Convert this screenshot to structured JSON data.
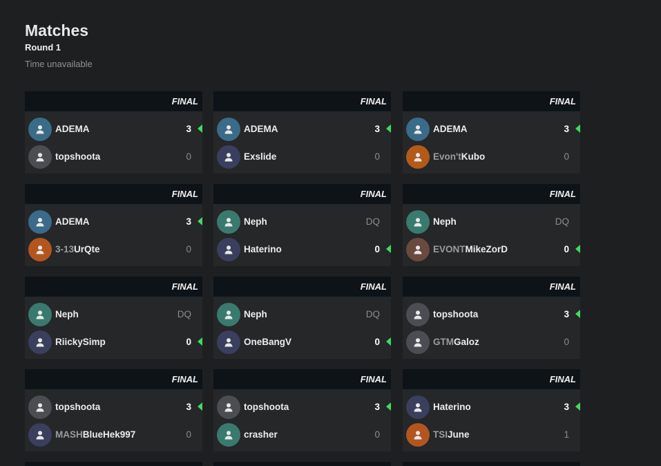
{
  "page": {
    "title": "Matches",
    "round": "Round 1",
    "time": "Time unavailable"
  },
  "colors": {
    "win_indicator": "#3ddc63"
  },
  "matches": [
    {
      "status": "FINAL",
      "players": [
        {
          "prefix": "",
          "name": "ADEMA",
          "score": "3",
          "winner": true,
          "avatar_color": "#3a6b88"
        },
        {
          "prefix": "",
          "name": "topshoota",
          "score": "0",
          "winner": false,
          "avatar_color": "#4a4e52"
        }
      ]
    },
    {
      "status": "FINAL",
      "players": [
        {
          "prefix": "",
          "name": "ADEMA",
          "score": "3",
          "winner": true,
          "avatar_color": "#3a6b88"
        },
        {
          "prefix": "",
          "name": "Exslide",
          "score": "0",
          "winner": false,
          "avatar_color": "#3a3f5e"
        }
      ]
    },
    {
      "status": "FINAL",
      "players": [
        {
          "prefix": "",
          "name": "ADEMA",
          "score": "3",
          "winner": true,
          "avatar_color": "#3a6b88"
        },
        {
          "prefix": "Evon't",
          "name": "Kubo",
          "score": "0",
          "winner": false,
          "avatar_color": "#b35a1a"
        }
      ]
    },
    {
      "status": "FINAL",
      "players": [
        {
          "prefix": "",
          "name": "ADEMA",
          "score": "3",
          "winner": true,
          "avatar_color": "#3a6b88"
        },
        {
          "prefix": "3-13",
          "name": "UrQte",
          "score": "0",
          "winner": false,
          "avatar_color": "#b3551f"
        }
      ]
    },
    {
      "status": "FINAL",
      "players": [
        {
          "prefix": "",
          "name": "Neph",
          "score": "DQ",
          "winner": false,
          "avatar_color": "#3a7a6e"
        },
        {
          "prefix": "",
          "name": "Haterino",
          "score": "0",
          "winner": true,
          "avatar_color": "#3a3f5e"
        }
      ]
    },
    {
      "status": "FINAL",
      "players": [
        {
          "prefix": "",
          "name": "Neph",
          "score": "DQ",
          "winner": false,
          "avatar_color": "#3a7a6e"
        },
        {
          "prefix": "EVONT",
          "name": "MikeZorD",
          "score": "0",
          "winner": true,
          "avatar_color": "#6a4a3e"
        }
      ]
    },
    {
      "status": "FINAL",
      "players": [
        {
          "prefix": "",
          "name": "Neph",
          "score": "DQ",
          "winner": false,
          "avatar_color": "#3a7a6e"
        },
        {
          "prefix": "",
          "name": "RiickySimp",
          "score": "0",
          "winner": true,
          "avatar_color": "#3a3f5e"
        }
      ]
    },
    {
      "status": "FINAL",
      "players": [
        {
          "prefix": "",
          "name": "Neph",
          "score": "DQ",
          "winner": false,
          "avatar_color": "#3a7a6e"
        },
        {
          "prefix": "",
          "name": "OneBangV",
          "score": "0",
          "winner": true,
          "avatar_color": "#3a3f5e"
        }
      ]
    },
    {
      "status": "FINAL",
      "players": [
        {
          "prefix": "",
          "name": "topshoota",
          "score": "3",
          "winner": true,
          "avatar_color": "#4a4e52"
        },
        {
          "prefix": "GTM",
          "name": "Galoz",
          "score": "0",
          "winner": false,
          "avatar_color": "#4a4e52"
        }
      ]
    },
    {
      "status": "FINAL",
      "players": [
        {
          "prefix": "",
          "name": "topshoota",
          "score": "3",
          "winner": true,
          "avatar_color": "#4a4e52"
        },
        {
          "prefix": "MASH",
          "name": "BlueHek997",
          "score": "0",
          "winner": false,
          "avatar_color": "#3a3f5e"
        }
      ]
    },
    {
      "status": "FINAL",
      "players": [
        {
          "prefix": "",
          "name": "topshoota",
          "score": "3",
          "winner": true,
          "avatar_color": "#4a4e52"
        },
        {
          "prefix": "",
          "name": "crasher",
          "score": "0",
          "winner": false,
          "avatar_color": "#3a7a6e"
        }
      ]
    },
    {
      "status": "FINAL",
      "players": [
        {
          "prefix": "",
          "name": "Haterino",
          "score": "3",
          "winner": true,
          "avatar_color": "#3a3f5e"
        },
        {
          "prefix": "TSI",
          "name": "June",
          "score": "1",
          "winner": false,
          "avatar_color": "#b3551f"
        }
      ]
    }
  ]
}
